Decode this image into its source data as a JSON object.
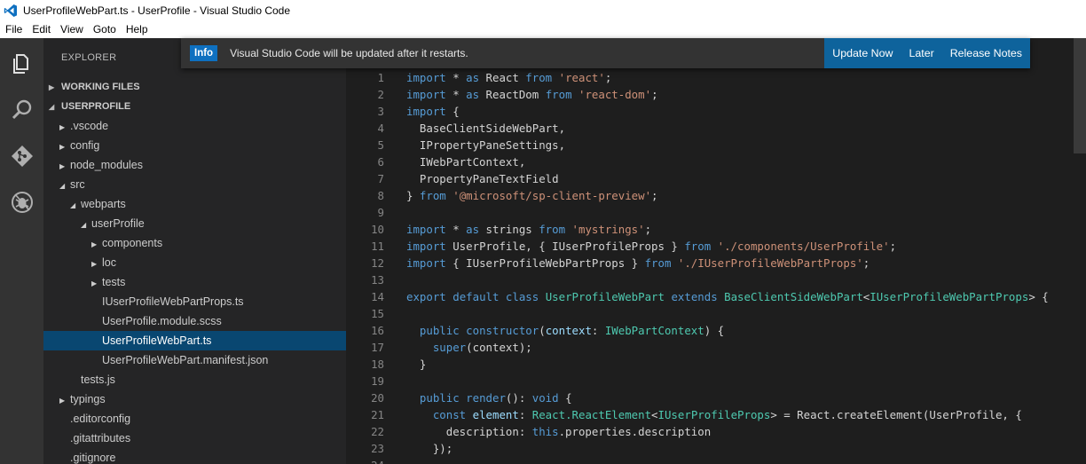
{
  "window": {
    "title": "UserProfileWebPart.ts - UserProfile - Visual Studio Code"
  },
  "menu": [
    "File",
    "Edit",
    "View",
    "Goto",
    "Help"
  ],
  "activity_icons": [
    "explorer-icon",
    "search-icon",
    "git-icon",
    "debug-icon"
  ],
  "explorer": {
    "title": "EXPLORER",
    "working_files": "WORKING FILES",
    "project": "USERPROFILE",
    "tree": [
      {
        "label": ".vscode",
        "depth": 0,
        "type": "folder",
        "state": "closed"
      },
      {
        "label": "config",
        "depth": 0,
        "type": "folder",
        "state": "closed"
      },
      {
        "label": "node_modules",
        "depth": 0,
        "type": "folder",
        "state": "closed"
      },
      {
        "label": "src",
        "depth": 0,
        "type": "folder",
        "state": "open"
      },
      {
        "label": "webparts",
        "depth": 1,
        "type": "folder",
        "state": "open"
      },
      {
        "label": "userProfile",
        "depth": 2,
        "type": "folder",
        "state": "open"
      },
      {
        "label": "components",
        "depth": 3,
        "type": "folder",
        "state": "closed"
      },
      {
        "label": "loc",
        "depth": 3,
        "type": "folder",
        "state": "closed"
      },
      {
        "label": "tests",
        "depth": 3,
        "type": "folder",
        "state": "closed"
      },
      {
        "label": "IUserProfileWebPartProps.ts",
        "depth": 3,
        "type": "file"
      },
      {
        "label": "UserProfile.module.scss",
        "depth": 3,
        "type": "file"
      },
      {
        "label": "UserProfileWebPart.ts",
        "depth": 3,
        "type": "file",
        "selected": true
      },
      {
        "label": "UserProfileWebPart.manifest.json",
        "depth": 3,
        "type": "file"
      },
      {
        "label": "tests.js",
        "depth": 1,
        "type": "file"
      },
      {
        "label": "typings",
        "depth": 0,
        "type": "folder",
        "state": "closed"
      },
      {
        "label": ".editorconfig",
        "depth": 0,
        "type": "file"
      },
      {
        "label": ".gitattributes",
        "depth": 0,
        "type": "file"
      },
      {
        "label": ".gitignore",
        "depth": 0,
        "type": "file"
      }
    ]
  },
  "notification": {
    "badge": "Info",
    "message": "Visual Studio Code will be updated after it restarts.",
    "actions": [
      "Update Now",
      "Later",
      "Release Notes"
    ],
    "accent": "#0e639c"
  },
  "colors": {
    "keyword": "#569cd6",
    "string": "#ce9178",
    "type": "#4ec9b0",
    "variable": "#9cdcfe",
    "plain": "#d4d4d4",
    "selection": "#094771"
  },
  "code": [
    [
      [
        "k",
        "import"
      ],
      [
        "p",
        " * "
      ],
      [
        "k",
        "as"
      ],
      [
        "p",
        " React "
      ],
      [
        "k",
        "from"
      ],
      [
        "p",
        " "
      ],
      [
        "s",
        "'react'"
      ],
      [
        "p",
        ";"
      ]
    ],
    [
      [
        "k",
        "import"
      ],
      [
        "p",
        " * "
      ],
      [
        "k",
        "as"
      ],
      [
        "p",
        " ReactDom "
      ],
      [
        "k",
        "from"
      ],
      [
        "p",
        " "
      ],
      [
        "s",
        "'react-dom'"
      ],
      [
        "p",
        ";"
      ]
    ],
    [
      [
        "k",
        "import"
      ],
      [
        "p",
        " {"
      ]
    ],
    [
      [
        "p",
        "  BaseClientSideWebPart,"
      ]
    ],
    [
      [
        "p",
        "  IPropertyPaneSettings,"
      ]
    ],
    [
      [
        "p",
        "  IWebPartContext,"
      ]
    ],
    [
      [
        "p",
        "  PropertyPaneTextField"
      ]
    ],
    [
      [
        "p",
        "} "
      ],
      [
        "k",
        "from"
      ],
      [
        "p",
        " "
      ],
      [
        "s",
        "'@microsoft/sp-client-preview'"
      ],
      [
        "p",
        ";"
      ]
    ],
    [],
    [
      [
        "k",
        "import"
      ],
      [
        "p",
        " * "
      ],
      [
        "k",
        "as"
      ],
      [
        "p",
        " strings "
      ],
      [
        "k",
        "from"
      ],
      [
        "p",
        " "
      ],
      [
        "s",
        "'mystrings'"
      ],
      [
        "p",
        ";"
      ]
    ],
    [
      [
        "k",
        "import"
      ],
      [
        "p",
        " UserProfile, { IUserProfileProps } "
      ],
      [
        "k",
        "from"
      ],
      [
        "p",
        " "
      ],
      [
        "s",
        "'./components/UserProfile'"
      ],
      [
        "p",
        ";"
      ]
    ],
    [
      [
        "k",
        "import"
      ],
      [
        "p",
        " { IUserProfileWebPartProps } "
      ],
      [
        "k",
        "from"
      ],
      [
        "p",
        " "
      ],
      [
        "s",
        "'./IUserProfileWebPartProps'"
      ],
      [
        "p",
        ";"
      ]
    ],
    [],
    [
      [
        "k",
        "export"
      ],
      [
        "p",
        " "
      ],
      [
        "k",
        "default"
      ],
      [
        "p",
        " "
      ],
      [
        "k",
        "class"
      ],
      [
        "p",
        " "
      ],
      [
        "t",
        "UserProfileWebPart"
      ],
      [
        "p",
        " "
      ],
      [
        "k",
        "extends"
      ],
      [
        "p",
        " "
      ],
      [
        "t",
        "BaseClientSideWebPart"
      ],
      [
        "p",
        "<"
      ],
      [
        "t",
        "IUserProfileWebPartProps"
      ],
      [
        "p",
        "> {"
      ]
    ],
    [],
    [
      [
        "p",
        "  "
      ],
      [
        "k",
        "public"
      ],
      [
        "p",
        " "
      ],
      [
        "k",
        "constructor"
      ],
      [
        "p",
        "("
      ],
      [
        "v",
        "context"
      ],
      [
        "p",
        ": "
      ],
      [
        "t",
        "IWebPartContext"
      ],
      [
        "p",
        ") {"
      ]
    ],
    [
      [
        "p",
        "    "
      ],
      [
        "k",
        "super"
      ],
      [
        "p",
        "(context);"
      ]
    ],
    [
      [
        "p",
        "  }"
      ]
    ],
    [],
    [
      [
        "p",
        "  "
      ],
      [
        "k",
        "public"
      ],
      [
        "p",
        " "
      ],
      [
        "k",
        "render"
      ],
      [
        "p",
        "(): "
      ],
      [
        "k",
        "void"
      ],
      [
        "p",
        " {"
      ]
    ],
    [
      [
        "p",
        "    "
      ],
      [
        "k",
        "const"
      ],
      [
        "p",
        " "
      ],
      [
        "v",
        "element"
      ],
      [
        "p",
        ": "
      ],
      [
        "t",
        "React.ReactElement"
      ],
      [
        "p",
        "<"
      ],
      [
        "t",
        "IUserProfileProps"
      ],
      [
        "p",
        "> = React.createElement(UserProfile, {"
      ]
    ],
    [
      [
        "p",
        "      description: "
      ],
      [
        "k",
        "this"
      ],
      [
        "p",
        ".properties.description"
      ]
    ],
    [
      [
        "p",
        "    });"
      ]
    ],
    []
  ]
}
